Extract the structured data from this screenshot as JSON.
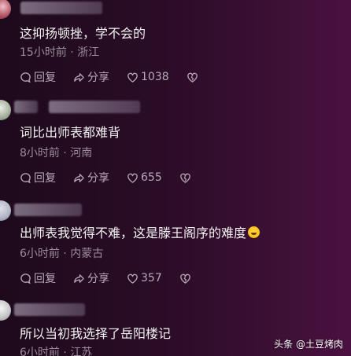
{
  "comments": [
    {
      "text": "这抑扬顿挫，学不会的",
      "meta": "15小时前 · 浙江",
      "reply_label": "回复",
      "share_label": "分享",
      "likes": "1038"
    },
    {
      "text": "词比出师表都难背",
      "meta": "8小时前 · 河南",
      "reply_label": "回复",
      "share_label": "分享",
      "likes": "655"
    },
    {
      "text": "出师表我觉得不难，这是滕王阁序的难度",
      "meta": "6小时前 · 内蒙古",
      "reply_label": "回复",
      "share_label": "分享",
      "likes": "357"
    },
    {
      "text": "所以当初我选择了岳阳楼记",
      "meta": "6小时前 · 江苏"
    }
  ],
  "watermark": "头条 @土豆烤肉",
  "colors": {
    "background": "#2a0c26",
    "text": "#f2f2f2",
    "meta": "#9a8c98",
    "action": "#b8aab6"
  }
}
